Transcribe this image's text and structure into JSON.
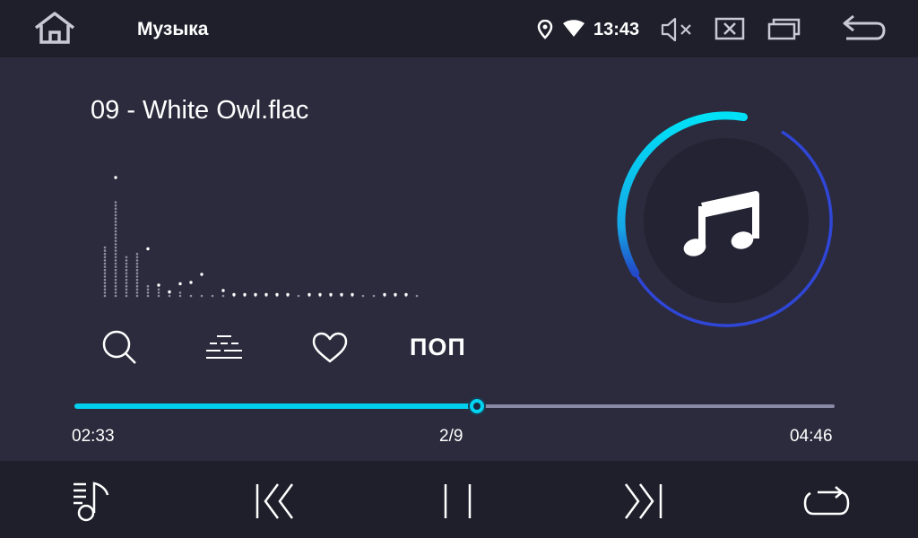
{
  "status_bar": {
    "title": "Музыка",
    "time": "13:43",
    "icons": [
      "home-icon",
      "location-icon",
      "wifi-icon",
      "mute-icon",
      "close-box-icon",
      "recent-apps-icon",
      "back-icon"
    ]
  },
  "player": {
    "track_title": "09 - White Owl.flac",
    "genre": "ПОП",
    "elapsed": "02:33",
    "track_position": "2/9",
    "duration": "04:46",
    "progress": 0.529,
    "album_icon": "music-note-icon",
    "ring_progress": 0.36,
    "action_icons": [
      "search-icon",
      "equalizer-icon",
      "heart-icon"
    ]
  },
  "spectrum": {
    "levels": [
      0.38,
      0.72,
      0.3,
      0.33,
      0.1,
      0.06,
      0.05,
      0.05,
      0.03,
      0.02,
      0.01,
      0.01,
      0.01,
      0.01,
      0.01,
      0.01,
      0.01,
      0.01,
      0.01,
      0.01,
      0.01,
      0.01,
      0.01,
      0.01,
      0.01,
      0.01,
      0.01,
      0.01,
      0.01,
      0.01
    ],
    "peaks": [
      0.98,
      0.88,
      0.0,
      0.0,
      0.35,
      0.08,
      0.03,
      0.09,
      0.1,
      0.16,
      0.0,
      0.04,
      0.01,
      0.01,
      0.01,
      0.01,
      0.01,
      0.01,
      0.0,
      0.01,
      0.01,
      0.01,
      0.01,
      0.01,
      0.0,
      0.0,
      0.01,
      0.01,
      0.01,
      0.0
    ]
  },
  "controls": {
    "icons": [
      "playlist-icon",
      "previous-icon",
      "pause-icon",
      "next-icon",
      "repeat-icon"
    ]
  },
  "colors": {
    "background": "#2b2b3d",
    "bars": "#1f1f2c",
    "accent": "#00cfee",
    "ring_outer": "#2f46d6",
    "disc": "#232334",
    "track": "#8b8aa6"
  }
}
